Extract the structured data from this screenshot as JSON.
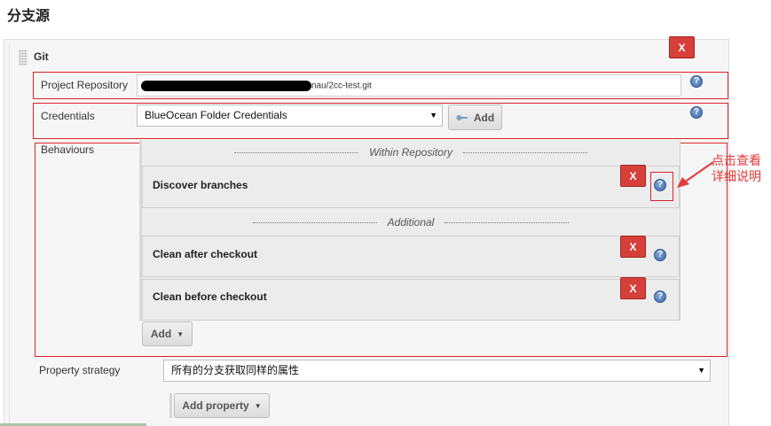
{
  "page": {
    "title": "分支源"
  },
  "source": {
    "type_label": "Git",
    "delete_label": "X",
    "project_repository": {
      "label": "Project Repository",
      "value_visible": "nau/2cc-test.git"
    },
    "credentials": {
      "label": "Credentials",
      "selected": "BlueOcean Folder Credentials",
      "add_button": "Add"
    },
    "behaviours": {
      "label": "Behaviours",
      "sections": [
        {
          "title": "Within Repository"
        },
        {
          "title": "Additional"
        }
      ],
      "items": [
        {
          "label": "Discover branches",
          "delete_label": "X"
        },
        {
          "label": "Clean after checkout",
          "delete_label": "X"
        },
        {
          "label": "Clean before checkout",
          "delete_label": "X"
        }
      ],
      "add_button": "Add"
    },
    "property_strategy": {
      "label": "Property strategy",
      "selected": "所有的分支获取同样的属性"
    },
    "add_property_button": "Add property"
  },
  "help_icon_glyph": "?",
  "annotation": {
    "line1": "点击查看",
    "line2": "详细说明",
    "color": "#e23a3a"
  },
  "colors": {
    "delete_button": "#d5403a",
    "highlight_box": "#d9232a",
    "help_icon": "#3e6aa7"
  }
}
